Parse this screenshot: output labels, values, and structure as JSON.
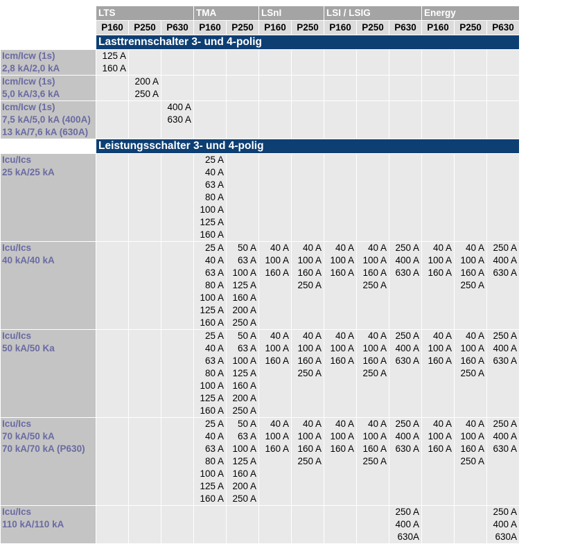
{
  "groups": [
    "LTS",
    "TMA",
    "LSnI",
    "LSI / LSIG",
    "Energy"
  ],
  "columns": [
    "P160",
    "P250",
    "P630",
    "P160",
    "P250",
    "P160",
    "P250",
    "P160",
    "P250",
    "P630",
    "P160",
    "P250",
    "P630"
  ],
  "sections": [
    {
      "title": "Lasttrennschalter 3- und 4-polig",
      "rows": [
        {
          "label": [
            "Icm/Icw (1s)",
            "2,8 kA/2,0 kA"
          ],
          "cells": [
            [
              "125 A",
              "160 A"
            ],
            [],
            [],
            [],
            [],
            [],
            [],
            [],
            [],
            [],
            [],
            [],
            []
          ]
        },
        {
          "label": [
            "Icm/Icw (1s)",
            "5,0 kA/3,6 kA"
          ],
          "cells": [
            [],
            [
              "200 A",
              "250 A"
            ],
            [],
            [],
            [],
            [],
            [],
            [],
            [],
            [],
            [],
            [],
            []
          ]
        },
        {
          "label": [
            "Icm/Icw (1s)",
            "7,5 kA/5,0 kA (400A)",
            "13 kA/7,6 kA (630A)"
          ],
          "cells": [
            [],
            [],
            [
              "400 A",
              "630 A"
            ],
            [],
            [],
            [],
            [],
            [],
            [],
            [],
            [],
            [],
            []
          ]
        }
      ]
    },
    {
      "title": "Leistungsschalter 3- und 4-polig",
      "rows": [
        {
          "label": [
            "Icu/Ics",
            "25 kA/25 kA"
          ],
          "cells": [
            [],
            [],
            [],
            [
              "25 A",
              "40 A",
              "63 A",
              "80 A",
              "100 A",
              "125 A",
              "160 A"
            ],
            [],
            [],
            [],
            [],
            [],
            [],
            [],
            [],
            []
          ]
        },
        {
          "label": [
            "Icu/Ics",
            "40 kA/40 kA"
          ],
          "cells": [
            [],
            [],
            [],
            [
              "25 A",
              "40 A",
              "63 A",
              "80 A",
              "100 A",
              "125 A",
              "160 A"
            ],
            [
              "50 A",
              "63 A",
              "100 A",
              "125 A",
              "160 A",
              "200 A",
              "250 A"
            ],
            [
              "40 A",
              "100 A",
              "160 A"
            ],
            [
              "40 A",
              "100 A",
              "160 A",
              "250 A"
            ],
            [
              "40 A",
              "100 A",
              "160 A"
            ],
            [
              "40 A",
              "100 A",
              "160 A",
              "250 A"
            ],
            [
              "250 A",
              "400 A",
              "630 A"
            ],
            [
              "40 A",
              "100 A",
              "160 A"
            ],
            [
              "40 A",
              "100 A",
              "160 A",
              "250 A"
            ],
            [
              "250 A",
              "400 A",
              "630 A"
            ]
          ]
        },
        {
          "label": [
            "Icu/Ics",
            "50 kA/50 Ka"
          ],
          "cells": [
            [],
            [],
            [],
            [
              "25 A",
              "40 A",
              "63 A",
              "80 A",
              "100 A",
              "125 A",
              "160 A"
            ],
            [
              "50 A",
              "63 A",
              "100 A",
              "125 A",
              "160 A",
              "200 A",
              "250 A"
            ],
            [
              "40 A",
              "100 A",
              "160 A"
            ],
            [
              "40 A",
              "100 A",
              "160 A",
              "250 A"
            ],
            [
              "40 A",
              "100 A",
              "160 A"
            ],
            [
              "40 A",
              "100 A",
              "160 A",
              "250 A"
            ],
            [
              "250 A",
              "400 A",
              "630 A"
            ],
            [
              "40 A",
              "100 A",
              "160 A"
            ],
            [
              "40 A",
              "100 A",
              "160 A",
              "250 A"
            ],
            [
              "250 A",
              "400 A",
              "630 A"
            ]
          ]
        },
        {
          "label": [
            "Icu/Ics",
            "70 kA/50 kA",
            "70 kA/70 kA (P630)"
          ],
          "cells": [
            [],
            [],
            [],
            [
              "25 A",
              "40 A",
              "63 A",
              "80 A",
              "100 A",
              "125 A",
              "160 A"
            ],
            [
              "50 A",
              "63 A",
              "100 A",
              "125 A",
              "160 A",
              "200 A",
              "250 A"
            ],
            [
              "40 A",
              "100 A",
              "160 A"
            ],
            [
              "40 A",
              "100 A",
              "160 A",
              "250 A"
            ],
            [
              "40 A",
              "100 A",
              "160 A"
            ],
            [
              "40 A",
              "100 A",
              "160 A",
              "250 A"
            ],
            [
              "250 A",
              "400 A",
              "630 A"
            ],
            [
              "40 A",
              "100 A",
              "160 A"
            ],
            [
              "40 A",
              "100 A",
              "160 A",
              "250 A"
            ],
            [
              "250 A",
              "400 A",
              "630 A"
            ]
          ]
        },
        {
          "label": [
            "Icu/Ics",
            "110 kA/110 kA"
          ],
          "cells": [
            [],
            [],
            [],
            [],
            [],
            [],
            [],
            [],
            [],
            [
              "250 A",
              "400 A",
              "630A"
            ],
            [],
            [],
            [
              "250 A",
              "400 A",
              "630A"
            ]
          ]
        }
      ]
    }
  ]
}
